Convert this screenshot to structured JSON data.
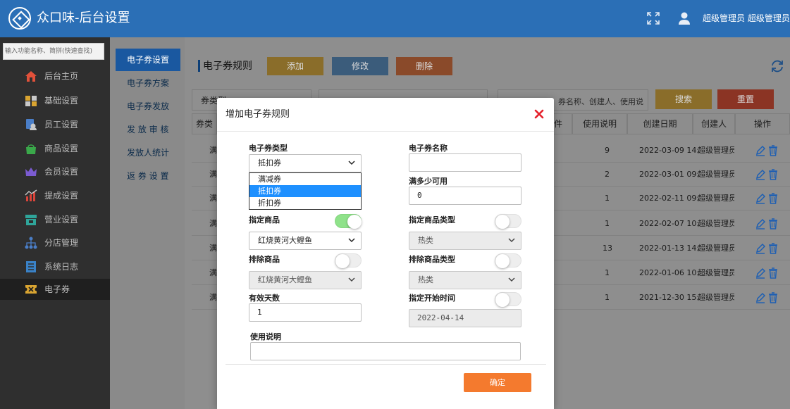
{
  "header": {
    "app_title": "众口味-后台设置",
    "user_name": "超级管理员 超级管理员"
  },
  "sidebar": {
    "search_placeholder": "输入功能名称、简拼(快速查找)",
    "items": [
      {
        "label": "后台主页",
        "icon": "home-icon",
        "color": "#e2513a"
      },
      {
        "label": "基础设置",
        "icon": "puzzle-icon",
        "color": "#d9a431"
      },
      {
        "label": "员工设置",
        "icon": "staff-icon",
        "color": "#4a7ec7"
      },
      {
        "label": "商品设置",
        "icon": "bag-icon",
        "color": "#3aa84a"
      },
      {
        "label": "会员设置",
        "icon": "crown-icon",
        "color": "#7b5bd1"
      },
      {
        "label": "提成设置",
        "icon": "chart-icon",
        "color": "#d9443a"
      },
      {
        "label": "营业设置",
        "icon": "store-icon",
        "color": "#2fa59a"
      },
      {
        "label": "分店管理",
        "icon": "branch-icon",
        "color": "#4a7ec7"
      },
      {
        "label": "系统日志",
        "icon": "log-icon",
        "color": "#3a82c7"
      },
      {
        "label": "电子券",
        "icon": "coupon-icon",
        "color": "#d9a431"
      }
    ]
  },
  "subnav": {
    "items": [
      "电子券设置",
      "电子券方案",
      "电子券发放",
      "发 放 审 核",
      "发放人统计",
      "返 券 设 置"
    ]
  },
  "main": {
    "page_title": "电子券规则",
    "add_label": "添加",
    "edit_label": "修改",
    "delete_label": "删除",
    "filter_label": "券类型",
    "search_placeholder": "券名称、创建人、使用说",
    "search_label": "搜索",
    "reset_label": "重置",
    "columns": [
      "券类",
      "件",
      "使用说明",
      "创建日期",
      "创建人",
      "操作"
    ],
    "rows": [
      {
        "type": "满",
        "usage": "9",
        "date": "2022-03-09 14:",
        "creator": "超级管理员"
      },
      {
        "type": "满",
        "usage": "2",
        "date": "2022-03-01 09:",
        "creator": "超级管理员"
      },
      {
        "type": "满",
        "usage": "1",
        "date": "2022-02-11 09:",
        "creator": "超级管理员"
      },
      {
        "type": "满",
        "usage": "1",
        "date": "2022-02-07 10:",
        "creator": "超级管理员"
      },
      {
        "type": "满",
        "usage": "13",
        "date": "2022-01-13 14:",
        "creator": "超级管理员"
      },
      {
        "type": "满",
        "usage": "1",
        "date": "2022-01-06 10:",
        "creator": "超级管理员"
      },
      {
        "type": "满",
        "usage": "1",
        "date": "2021-12-30 15:",
        "creator": "超级管理员"
      }
    ]
  },
  "modal": {
    "title": "增加电子券规则",
    "type_label": "电子券类型",
    "type_value": "抵扣券",
    "type_options": [
      "满减券",
      "抵扣券",
      "折扣券"
    ],
    "name_label": "电子券名称",
    "name_value": "",
    "min_label": "满多少可用",
    "min_value": "0",
    "goods_label": "指定商品",
    "goods_toggle_on": true,
    "goods_value": "红烧黄河大鲤鱼",
    "goods_type_label": "指定商品类型",
    "goods_type_toggle_on": false,
    "goods_type_value": "热类",
    "exclude_label": "排除商品",
    "exclude_toggle_on": false,
    "exclude_value": "红烧黄河大鲤鱼",
    "exclude_type_label": "排除商品类型",
    "exclude_type_toggle_on": false,
    "exclude_type_value": "热类",
    "days_label": "有效天数",
    "days_value": "1",
    "start_label": "指定开始时间",
    "start_toggle_on": false,
    "start_value": "2022-04-14",
    "desc_label": "使用说明",
    "desc_value": "",
    "ok_label": "确定"
  }
}
